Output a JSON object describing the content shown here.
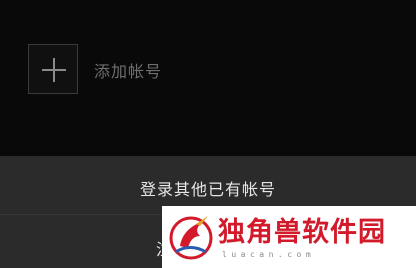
{
  "account_list": {
    "add_account_label": "添加帐号",
    "add_icon": "plus-icon"
  },
  "action_sheet": {
    "login_existing_label": "登录其他已有帐号",
    "register_label_partial": "注"
  },
  "watermark": {
    "title": "独角兽软件园",
    "url": "luacan.com",
    "logo_icon": "unicorn-logo-icon",
    "colors": {
      "title": "#d21a2a",
      "background": "#ffffff"
    }
  },
  "colors": {
    "background": "#090909",
    "sheet_background": "#2b2b2b",
    "sheet_text": "#e6e6e6",
    "dim_text": "#6e6e6e"
  }
}
